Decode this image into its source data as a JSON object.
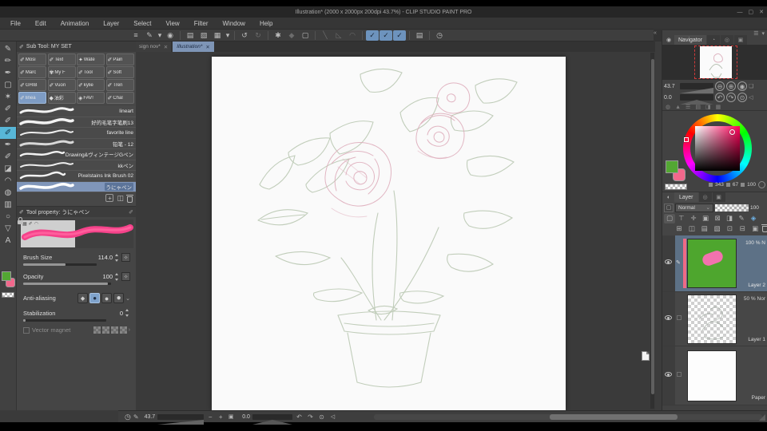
{
  "window": {
    "title": "Illustration* (2000 x 2000px 200dpi 43.7%)  - CLIP STUDIO PAINT PRO",
    "minimize": "—",
    "maximize": "▢",
    "close": "✕"
  },
  "menu": {
    "items": [
      "File",
      "Edit",
      "Animation",
      "Layer",
      "Select",
      "View",
      "Filter",
      "Window",
      "Help"
    ]
  },
  "toolbar": {
    "icons": [
      {
        "name": "main-menu",
        "glyph": "≡"
      },
      {
        "name": "pen-tool",
        "glyph": "✎"
      },
      {
        "name": "pen-dropdown",
        "glyph": "▾"
      },
      {
        "name": "color-wheel",
        "glyph": "◉"
      },
      {
        "name": "new-canvas",
        "glyph": "▤"
      },
      {
        "name": "open-file",
        "glyph": "▧"
      },
      {
        "name": "export",
        "glyph": "▦"
      },
      {
        "name": "export-dropdown",
        "glyph": "▾"
      },
      {
        "name": "undo",
        "glyph": "↺"
      },
      {
        "name": "redo",
        "glyph": "↻"
      },
      {
        "name": "clear",
        "glyph": "✱"
      },
      {
        "name": "fill",
        "glyph": "◆"
      },
      {
        "name": "frame",
        "glyph": "▢"
      },
      {
        "name": "straight-line",
        "glyph": "╲"
      },
      {
        "name": "lasso",
        "glyph": "◺"
      },
      {
        "name": "arc",
        "glyph": "◠"
      },
      {
        "name": "snap-ruler",
        "glyph": "✓"
      },
      {
        "name": "snap-special-ruler",
        "glyph": "✓"
      },
      {
        "name": "snap-grid",
        "glyph": "✓"
      },
      {
        "name": "material",
        "glyph": "▤"
      },
      {
        "name": "timelapse",
        "glyph": "◷"
      }
    ]
  },
  "canvas_tabs": {
    "inactive": "sign nov*",
    "active": "Illustration*",
    "close": "✕"
  },
  "left_tools": [
    "✎",
    "✏",
    "✒",
    "▢",
    "✶",
    "✐",
    "✐",
    "✐",
    "✒",
    "✐",
    "◪",
    "◠",
    "◍",
    "▥",
    "○",
    "▽",
    "A"
  ],
  "subtool": {
    "title": "Sub Tool: MY SET",
    "grid": [
      {
        "label": "Mosi",
        "icon": "✐"
      },
      {
        "label": "Text",
        "icon": "✐"
      },
      {
        "label": "Wate",
        "icon": "✦"
      },
      {
        "label": "Pain",
        "icon": "✐"
      },
      {
        "label": "Marc",
        "icon": "✐"
      },
      {
        "label": "My F",
        "icon": "✾"
      },
      {
        "label": "Tool",
        "icon": "✐"
      },
      {
        "label": "Soft",
        "icon": "✐"
      },
      {
        "label": "GHIB",
        "icon": "✐"
      },
      {
        "label": "Vuon",
        "icon": "✐"
      },
      {
        "label": "kylie",
        "icon": "✐"
      },
      {
        "label": "Tren",
        "icon": "✐"
      },
      {
        "label": "linea",
        "icon": "✐"
      },
      {
        "label": "油彩",
        "icon": "◆"
      },
      {
        "label": "FAV!",
        "icon": "◈"
      },
      {
        "label": "Chal",
        "icon": "✐"
      }
    ],
    "brushes": [
      "lineart",
      "好的毛笔字笔刷13",
      "favorite line",
      "铅笔 - 12",
      "Drawing&ヴィンテージGペン",
      "kkペン",
      "Pixelstains Ink Brush 02",
      "うにゃペン"
    ]
  },
  "tool_property": {
    "title": "Tool property: うにゃペン",
    "brush_size_label": "Brush Size",
    "brush_size_value": "114.0",
    "opacity_label": "Opacity",
    "opacity_value": "100",
    "anti_aliasing_label": "Anti-aliasing",
    "stabilization_label": "Stabilization",
    "stabilization_value": "0",
    "vector_magnet_label": "Vector magnet",
    "aa_icons": [
      "◆",
      "●",
      "●",
      "●"
    ]
  },
  "navigator": {
    "title": "Navigator",
    "zoom_value": "43.7",
    "rotate_value": "0.0",
    "zoom_out": "⊖",
    "zoom_in": "⊕",
    "fit": "◉",
    "rot_left": "↶",
    "rot_right": "↷",
    "reset": "⊙",
    "flip_h": "◁",
    "tab_icons": [
      "◔",
      "◎",
      "▣"
    ],
    "footer_icons": [
      "◍",
      "▲",
      "☰",
      "▤",
      "◨",
      "▦"
    ]
  },
  "color": {
    "h_value": "343",
    "s_value": "67",
    "v_value": "100",
    "fg_hex": "#53a733",
    "bg_hex": "#f2688c",
    "sv_hue_hex": "#ff0059"
  },
  "layer_panel": {
    "title": "Layer",
    "blend_mode": "Normal",
    "opacity_value": "100",
    "mode_icons": [
      "▢",
      "⊤",
      "✛",
      "▣",
      "⊠",
      "◨",
      "✎",
      "◈"
    ],
    "action_icons": [
      "⊞",
      "◫",
      "▤",
      "▧",
      "⊡",
      "⊟",
      "▣"
    ],
    "layers": [
      {
        "name": "Layer 2",
        "opacity_text": "100 % N"
      },
      {
        "name": "Layer 1",
        "opacity_text": "50 % Nor"
      },
      {
        "name": "Paper",
        "opacity_text": ""
      }
    ]
  },
  "statusbar": {
    "zoom_value": "43.7",
    "rotate_value": "0.0",
    "clock": "◷",
    "pen": "✎",
    "minus": "−",
    "plus": "+",
    "fit": "▣",
    "rot_left": "↶",
    "rot_right": "↷",
    "reset": "⊙",
    "flip": "◁"
  },
  "misc": {
    "collapse": "«",
    "chevron": "⌄",
    "arrow": "›",
    "panel_menu": "☰",
    "panel_min": "▾",
    "dropdown": "▾",
    "plus": "+",
    "dup": "◫"
  }
}
